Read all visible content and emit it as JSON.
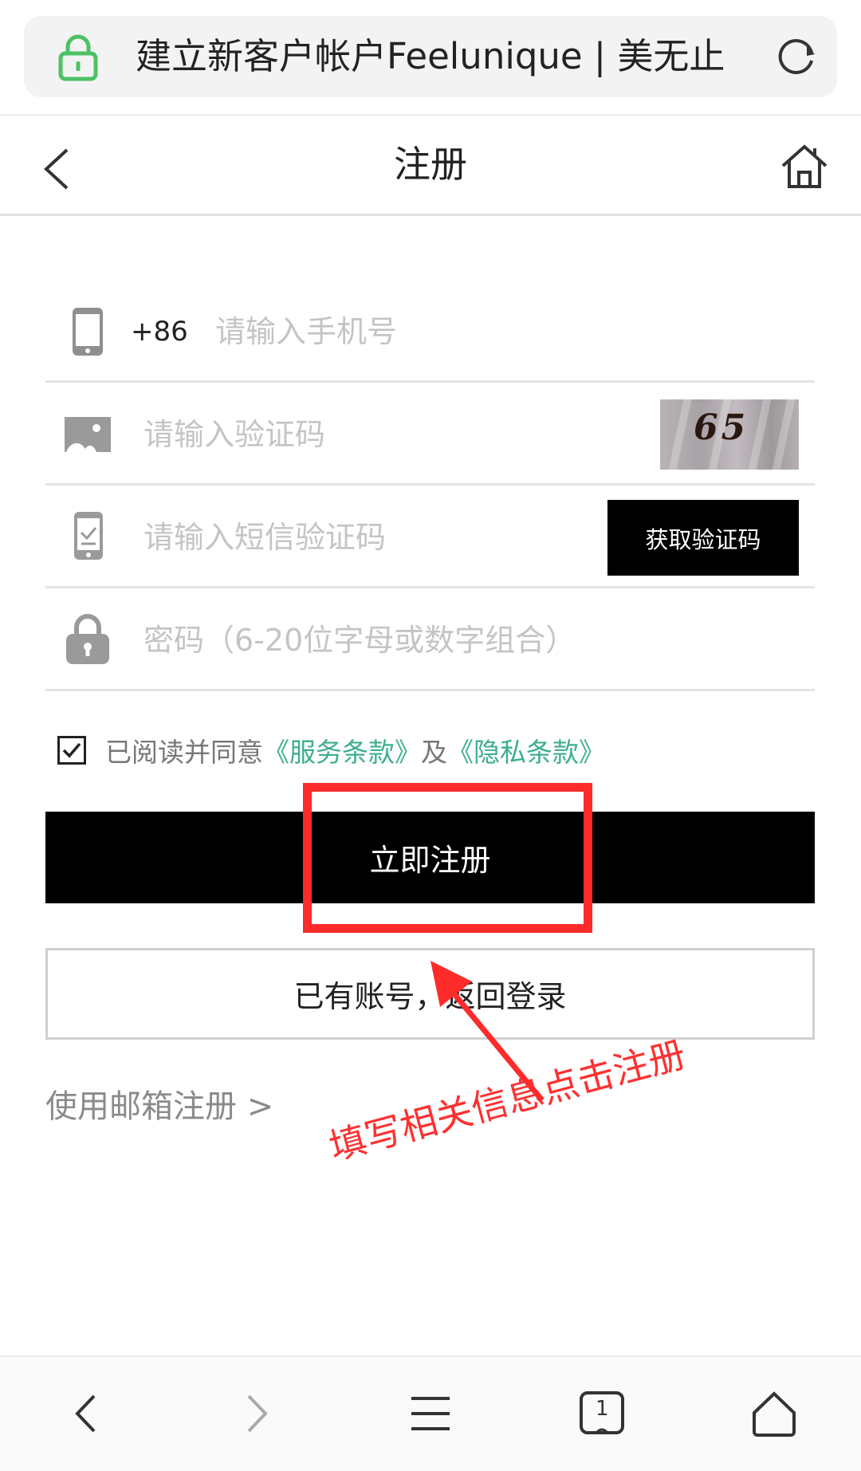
{
  "browser": {
    "url_title": "建立新客户帐户Feelunique | 美无止",
    "lock_icon": "lock-icon",
    "reload_icon": "reload-icon",
    "secure_color": "#4cc264"
  },
  "header": {
    "title": "注册",
    "back_icon": "chevron-left-icon",
    "home_icon": "home-icon"
  },
  "form": {
    "phone": {
      "country_code": "+86",
      "placeholder": "请输入手机号",
      "value": ""
    },
    "captcha": {
      "placeholder": "请输入验证码",
      "value": "",
      "image_text": "65"
    },
    "sms": {
      "placeholder": "请输入短信验证码",
      "value": "",
      "button_label": "获取验证码"
    },
    "password": {
      "placeholder": "密码（6-20位字母或数字组合）",
      "value": ""
    }
  },
  "agreement": {
    "checked": true,
    "prefix": "已阅读并同意",
    "terms_link": "《服务条款》",
    "joiner": "及",
    "privacy_link": "《隐私条款》",
    "link_color": "#3dae8f"
  },
  "actions": {
    "register_label": "立即注册",
    "login_label": "已有账号，返回登录",
    "email_register_label": "使用邮箱注册 >"
  },
  "annotation": {
    "text": "填写相关信息点击注册",
    "color": "#ff2a2a"
  },
  "bottom_nav": {
    "back_icon": "chevron-left-icon",
    "forward_icon": "chevron-right-icon",
    "menu_icon": "menu-icon",
    "tabs_icon": "tabs-icon",
    "tabs_count": "1",
    "home_icon": "home-icon"
  }
}
